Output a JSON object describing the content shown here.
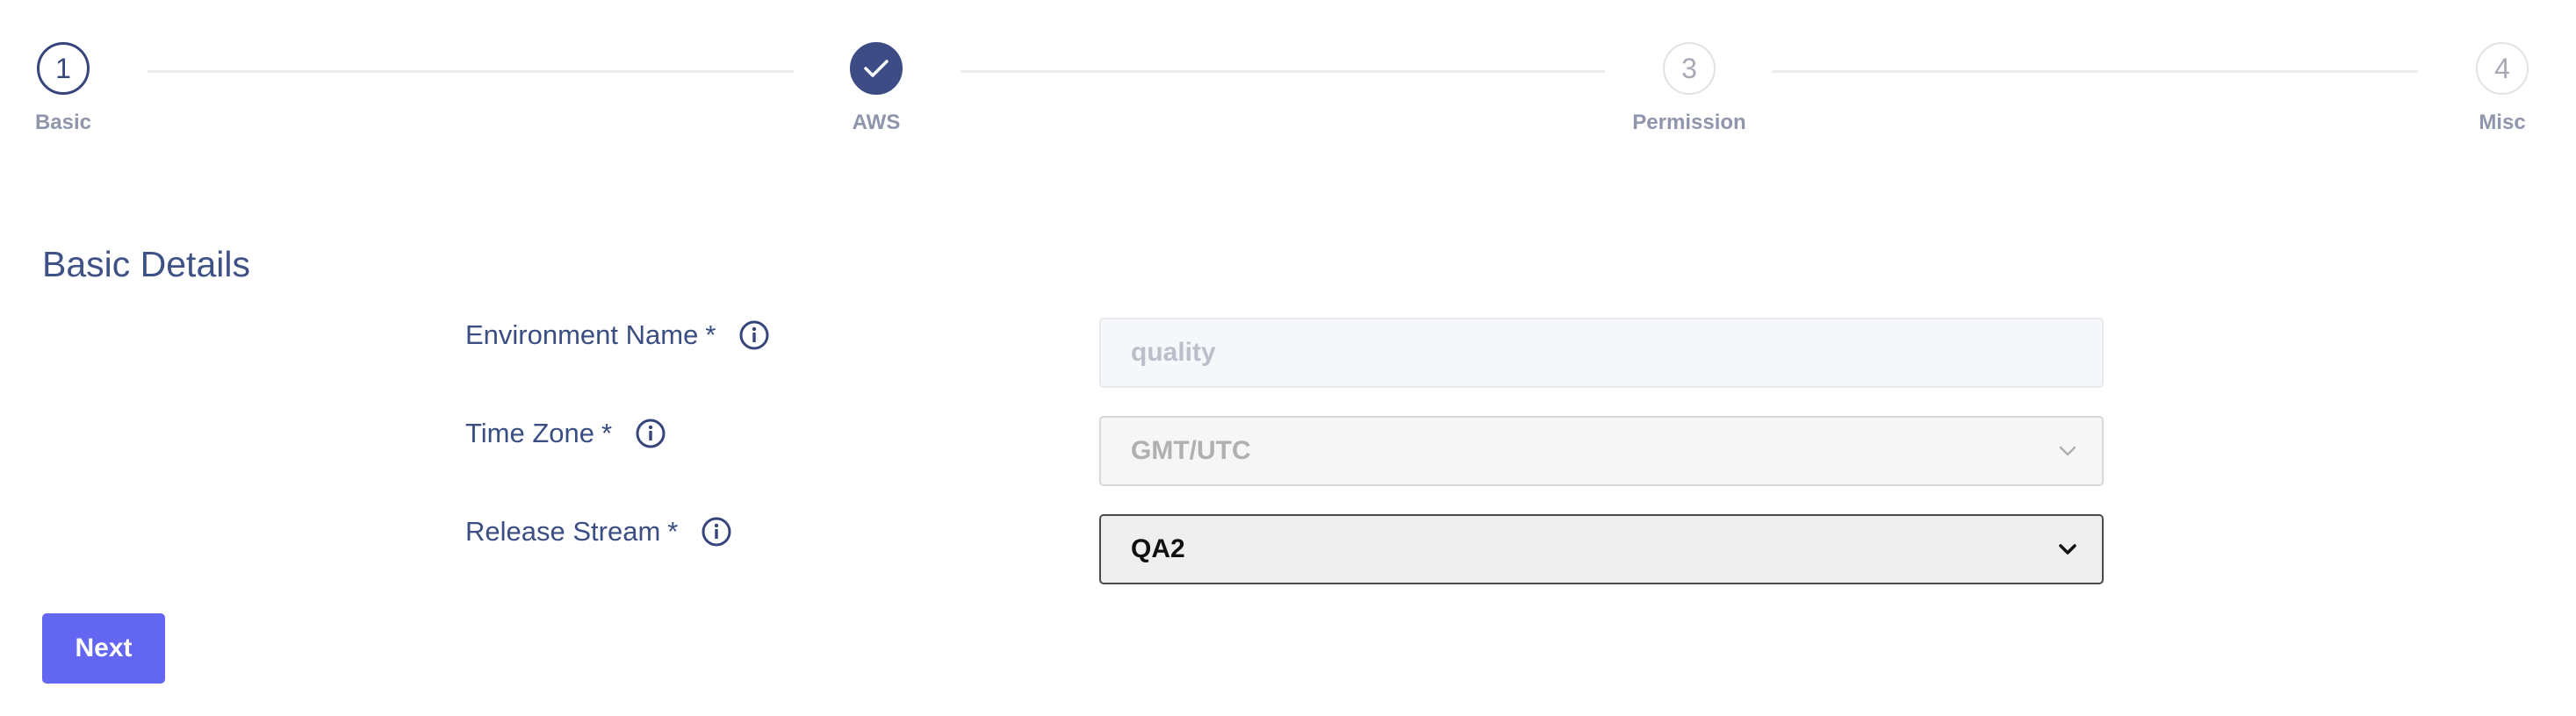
{
  "stepper": {
    "steps": [
      {
        "number": "1",
        "label": "Basic",
        "state": "active"
      },
      {
        "number": "",
        "label": "AWS",
        "state": "complete",
        "icon": "check-icon"
      },
      {
        "number": "3",
        "label": "Permission",
        "state": "pending"
      },
      {
        "number": "4",
        "label": "Misc",
        "state": "pending"
      }
    ]
  },
  "section": {
    "title": "Basic Details"
  },
  "form": {
    "environment_name": {
      "label": "Environment Name",
      "required_mark": "*",
      "value": "quality",
      "info_icon": "info-icon"
    },
    "time_zone": {
      "label": "Time Zone",
      "required_mark": "*",
      "value": "GMT/UTC",
      "info_icon": "info-icon"
    },
    "release_stream": {
      "label": "Release Stream",
      "required_mark": "*",
      "value": "QA2",
      "info_icon": "info-icon"
    }
  },
  "actions": {
    "next_label": "Next"
  },
  "colors": {
    "primary_button": "#6366f1",
    "stepper_active": "#3d4c84",
    "label_text": "#3a4e84"
  }
}
